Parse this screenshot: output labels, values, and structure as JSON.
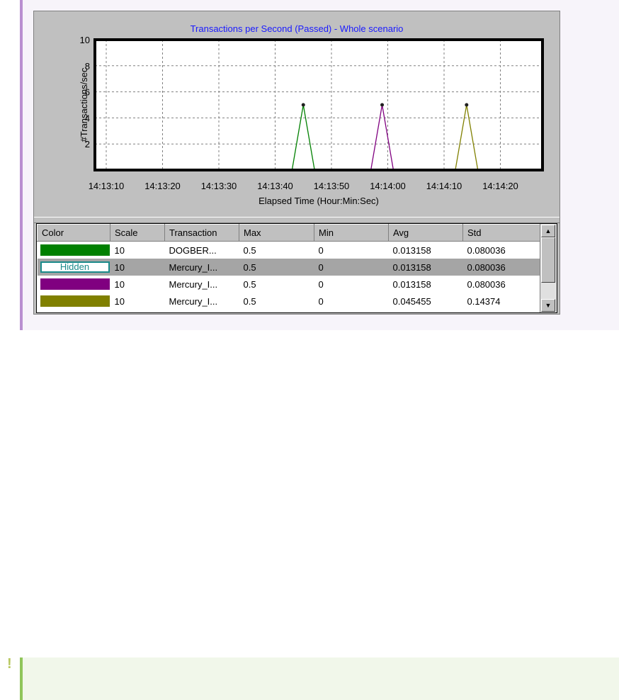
{
  "chart_data": {
    "type": "line",
    "title": "Transactions per Second (Passed) - Whole scenario",
    "xlabel": "Elapsed Time (Hour:Min:Sec)",
    "ylabel": "#Transactions/sec",
    "ylim": [
      0,
      10
    ],
    "yticks": [
      2,
      4,
      6,
      8,
      10
    ],
    "xticks": [
      "14:13:10",
      "14:13:20",
      "14:13:30",
      "14:13:40",
      "14:13:50",
      "14:14:00",
      "14:14:10",
      "14:14:20"
    ],
    "grid": true,
    "series": [
      {
        "color": "#008000",
        "points": [
          {
            "x": "14:13:43",
            "y": 0
          },
          {
            "x": "14:13:45",
            "y": 5
          },
          {
            "x": "14:13:47",
            "y": 0
          }
        ]
      },
      {
        "color": "#800080",
        "points": [
          {
            "x": "14:13:57",
            "y": 0
          },
          {
            "x": "14:13:59",
            "y": 5
          },
          {
            "x": "14:14:01",
            "y": 0
          }
        ]
      },
      {
        "color": "#808000",
        "points": [
          {
            "x": "14:14:12",
            "y": 0
          },
          {
            "x": "14:14:14",
            "y": 5
          },
          {
            "x": "14:14:16",
            "y": 0
          }
        ]
      }
    ]
  },
  "legend": {
    "columns": [
      "Color",
      "Scale",
      "Transaction",
      "Max",
      "Min",
      "Avg",
      "Std"
    ],
    "rows": [
      {
        "color": "#008000",
        "hidden": false,
        "color_label": "",
        "scale": "10",
        "transaction": "DOGBER...",
        "max": "0.5",
        "min": "0",
        "avg": "0.013158",
        "std": "0.080036"
      },
      {
        "color": "#ffffff",
        "hidden": true,
        "color_label": "Hidden",
        "scale": "10",
        "transaction": "Mercury_I...",
        "max": "0.5",
        "min": "0",
        "avg": "0.013158",
        "std": "0.080036"
      },
      {
        "color": "#800080",
        "hidden": false,
        "color_label": "",
        "scale": "10",
        "transaction": "Mercury_I...",
        "max": "0.5",
        "min": "0",
        "avg": "0.013158",
        "std": "0.080036"
      },
      {
        "color": "#808000",
        "hidden": false,
        "color_label": "",
        "scale": "10",
        "transaction": "Mercury_I...",
        "max": "0.5",
        "min": "0",
        "avg": "0.045455",
        "std": "0.14374"
      }
    ],
    "selected_row": 1
  },
  "scrollbar": {
    "up_icon": "arrow-up-icon",
    "down_icon": "arrow-down-icon"
  },
  "callout": {
    "icon": "exclamation-icon"
  }
}
